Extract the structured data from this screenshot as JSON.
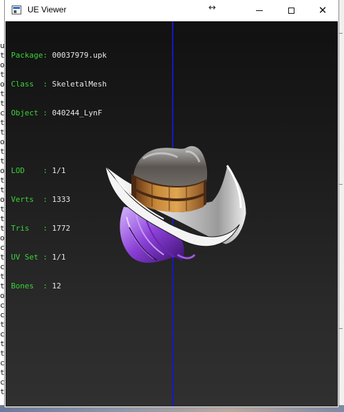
{
  "window": {
    "title": "UE Viewer"
  },
  "controls": {
    "move": "↔",
    "close": "✕"
  },
  "info_group1": [
    {
      "key": "Package:",
      "value": " 00037979.upk"
    },
    {
      "key": "Class  :",
      "value": " SkeletalMesh"
    },
    {
      "key": "Object :",
      "value": " 040244_LynF"
    }
  ],
  "info_group2": [
    {
      "key": "LOD    :",
      "value": " 1/1"
    },
    {
      "key": "Verts  :",
      "value": " 1333"
    },
    {
      "key": "Tris   :",
      "value": " 1772"
    },
    {
      "key": "UV Set :",
      "value": " 1/1"
    },
    {
      "key": "Bones  :",
      "value": " 12"
    }
  ],
  "background_console": {
    "glyphs": [
      "u",
      "t",
      "o",
      "t",
      "o",
      "t",
      "t",
      "c",
      "t",
      "t",
      "o",
      "t",
      "t",
      "o",
      "t",
      "t",
      "o",
      "t",
      "t",
      "t",
      "o",
      "c",
      "t",
      "c",
      "t",
      "t",
      "o",
      "c",
      "c",
      "t",
      "c",
      "t",
      "t",
      "c",
      "t",
      "c",
      "t"
    ]
  },
  "colors": {
    "label": "#3ad33a",
    "value": "#e8e8e8",
    "axis": "#1418c8"
  }
}
